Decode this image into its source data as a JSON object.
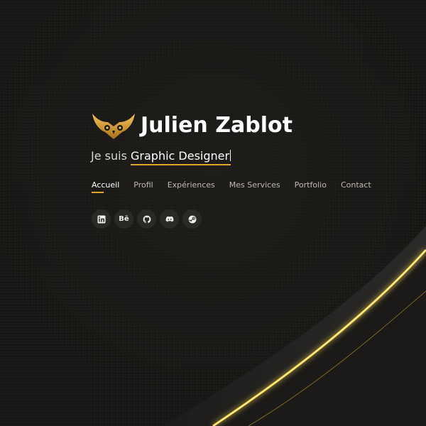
{
  "profile": {
    "name": "Julien Zablot",
    "tagline_prefix": "Je suis",
    "tagline_role": "Graphic Designer"
  },
  "nav": {
    "items": [
      {
        "label": "Accueil",
        "active": true
      },
      {
        "label": "Profil",
        "active": false
      },
      {
        "label": "Expériences",
        "active": false
      },
      {
        "label": "Mes Services",
        "active": false
      },
      {
        "label": "Portfolio",
        "active": false
      },
      {
        "label": "Contact",
        "active": false
      }
    ]
  },
  "socials": [
    {
      "icon": "linkedin-icon"
    },
    {
      "icon": "behance-icon",
      "label": "Bē"
    },
    {
      "icon": "github-icon"
    },
    {
      "icon": "discord-icon"
    },
    {
      "icon": "steam-icon"
    }
  ],
  "colors": {
    "background": "#171614",
    "accent": "#e0a62a",
    "text": "#ffffff",
    "muted": "#bdbab4",
    "icon_bg": "#2a2927"
  }
}
